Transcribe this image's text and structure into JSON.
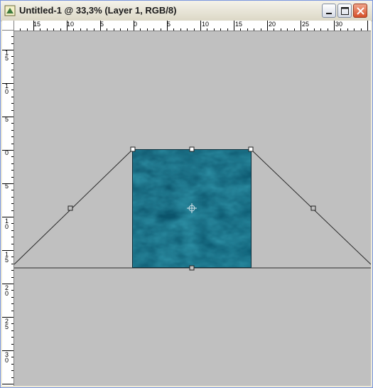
{
  "window": {
    "title": "Untitled-1 @ 33,3% (Layer 1, RGB/8)",
    "buttons": {
      "minimize": "minimize",
      "maximize": "maximize",
      "close": "close"
    }
  },
  "ruler_top": {
    "labels": [
      "15",
      "10",
      "5",
      "0",
      "5",
      "10",
      "15",
      "20",
      "25",
      "30"
    ]
  },
  "ruler_left": {
    "labels": [
      "1 5",
      "1 0",
      "5",
      "0",
      "5",
      "1 0",
      "1 5",
      "2 0",
      "2 5",
      "3 0"
    ]
  },
  "canvas": {
    "background": "#c0c0c0",
    "texture_color": "#0e5870",
    "guide_color": "#2a2a2a"
  }
}
